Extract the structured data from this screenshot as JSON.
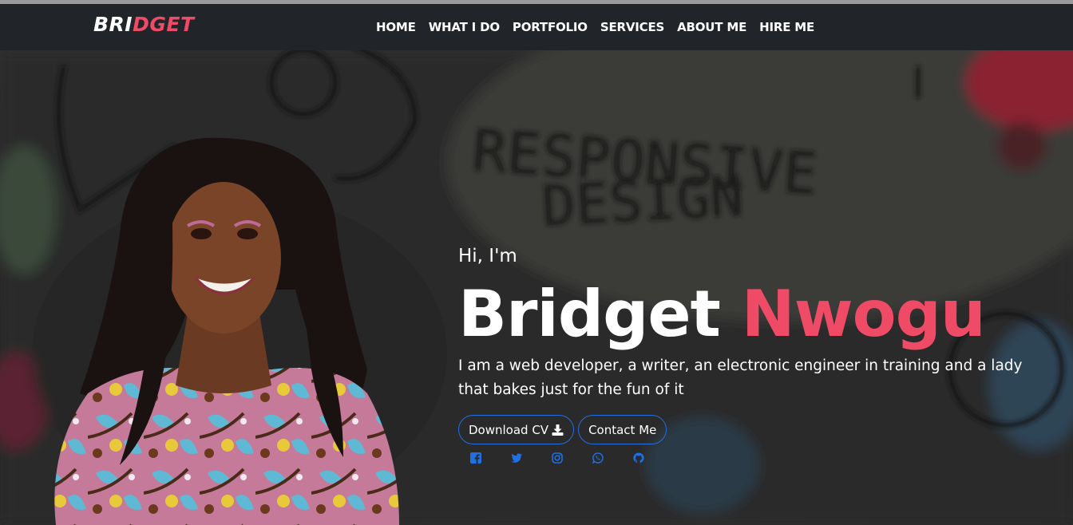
{
  "brand": {
    "part1": "BRI",
    "part2": "DGET"
  },
  "nav": {
    "items": [
      {
        "label": "HOME"
      },
      {
        "label": "WHAT I DO"
      },
      {
        "label": "PORTFOLIO"
      },
      {
        "label": "SERVICES"
      },
      {
        "label": "ABOUT ME"
      },
      {
        "label": "HIRE ME"
      }
    ]
  },
  "hero": {
    "greeting": "Hi, I'm",
    "first_name": "Bridget",
    "last_name": "Nwogu",
    "bio": "I am a web developer, a writer, an electronic engineer in training and a lady that bakes just for the fun of it",
    "background_text_1": "RESPONSIVE",
    "background_text_2": "DESIGN",
    "buttons": {
      "download_cv": "Download CV",
      "contact": "Contact Me"
    },
    "socials": [
      "facebook-icon",
      "twitter-icon",
      "instagram-icon",
      "whatsapp-icon",
      "github-icon"
    ]
  },
  "colors": {
    "accent": "#ef4a66",
    "navbar": "#212529",
    "button_border": "#1f6fe5",
    "social_icon": "#1f6fe5"
  }
}
